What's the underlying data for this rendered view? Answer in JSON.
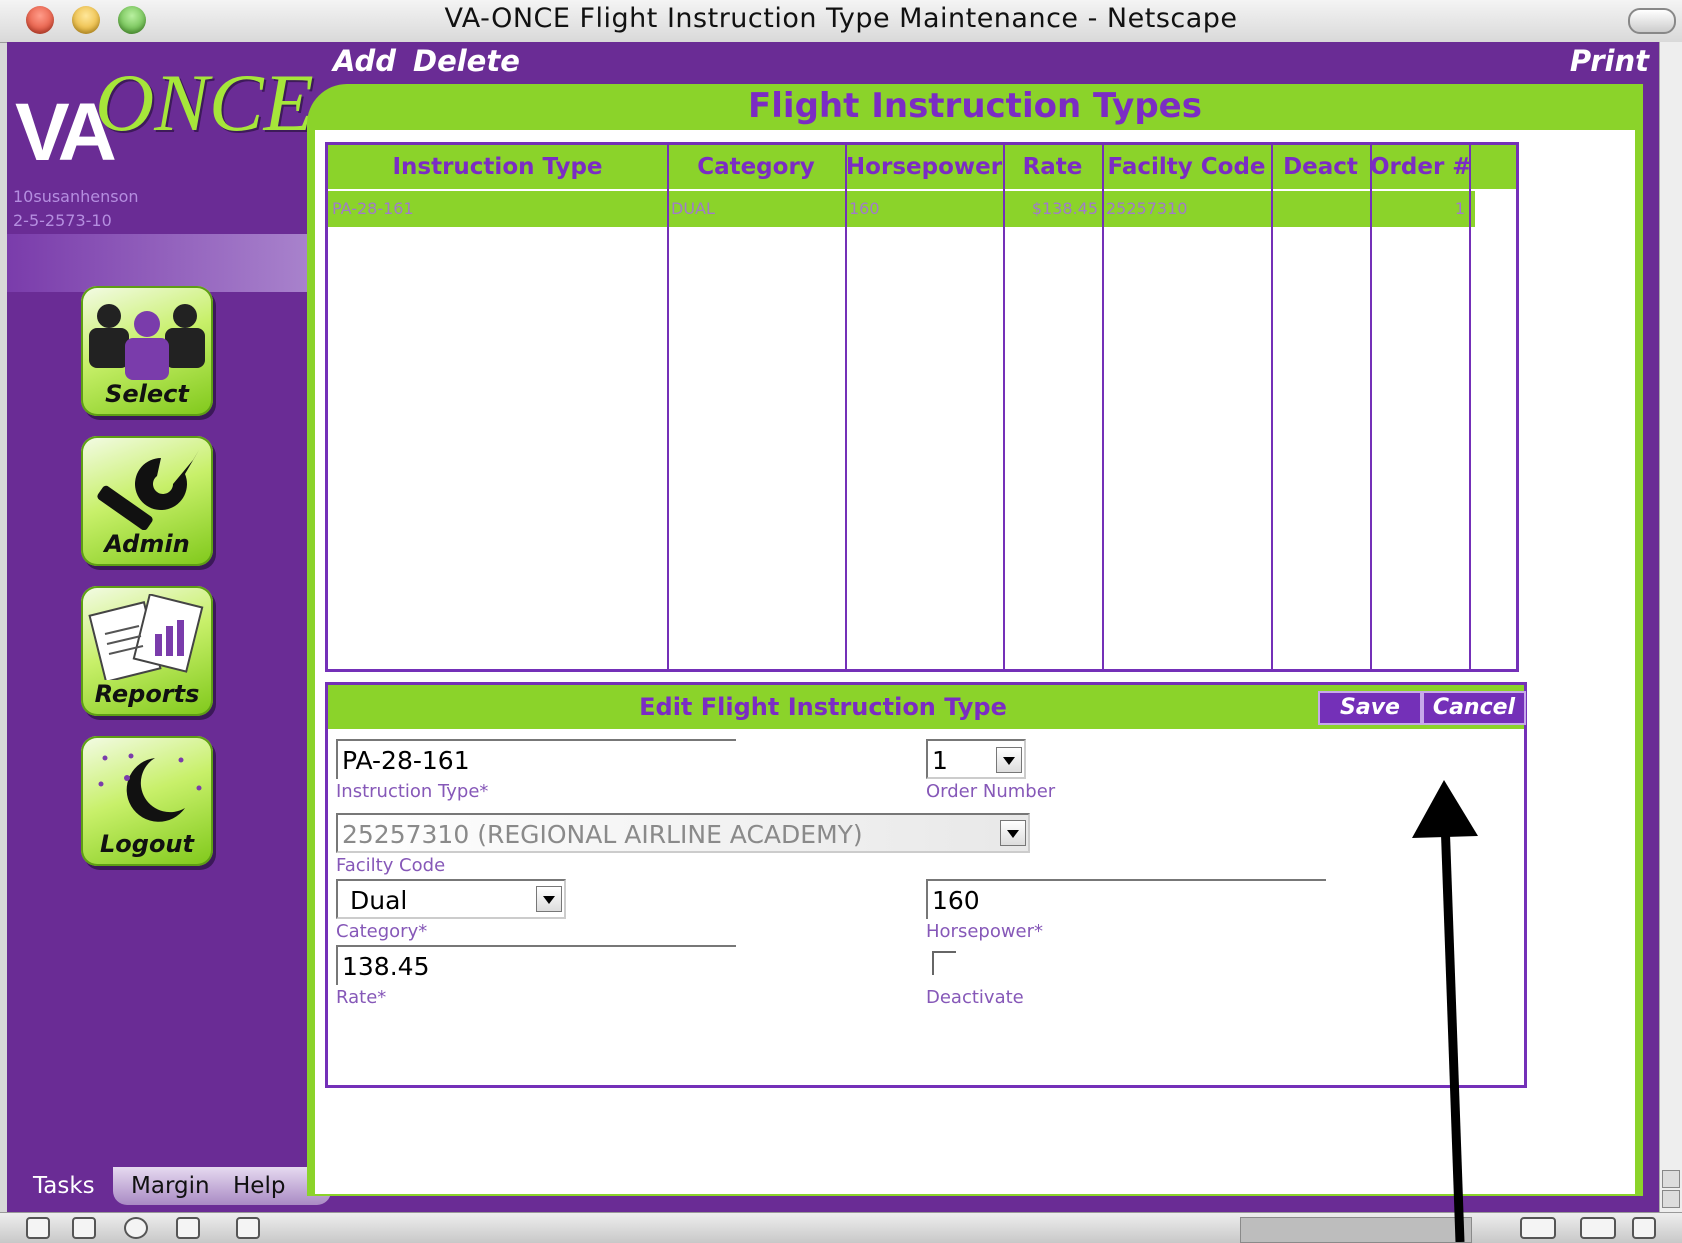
{
  "window": {
    "title": "VA-ONCE Flight Instruction Type Maintenance - Netscape"
  },
  "topbar": {
    "add_label": "Add",
    "delete_label": "Delete",
    "print_label": "Print"
  },
  "logo": {
    "va": "VA",
    "once": "ONCE"
  },
  "user": {
    "name": "10susanhenson",
    "id": "2-5-2573-10"
  },
  "nav": {
    "select_label": "Select",
    "admin_label": "Admin",
    "reports_label": "Reports",
    "logout_label": "Logout",
    "icons": [
      "people-icon",
      "wrench-icon",
      "reports-icon",
      "moon-icon"
    ]
  },
  "tabs": [
    "Tasks",
    "Margin",
    "Help"
  ],
  "page": {
    "title": "Flight Instruction Types"
  },
  "grid": {
    "headers": [
      "Instruction Type",
      "Category",
      "Horsepower",
      "Rate",
      "Facilty Code",
      "Deact",
      "Order #"
    ],
    "rows": [
      [
        "PA-28-161",
        "DUAL",
        "160",
        "$138.45",
        "25257310",
        "",
        "1"
      ]
    ]
  },
  "edit": {
    "title": "Edit Flight Instruction Type",
    "save_label": "Save",
    "cancel_label": "Cancel",
    "instruction_type": {
      "value": "PA-28-161",
      "label": "Instruction Type*"
    },
    "order_number": {
      "value": "1",
      "label": "Order Number"
    },
    "facility_code": {
      "value": "25257310 (REGIONAL AIRLINE ACADEMY)",
      "label": "Facilty Code"
    },
    "category": {
      "value": "Dual",
      "label": "Category*"
    },
    "horsepower": {
      "value": "160",
      "label": "Horsepower*"
    },
    "rate": {
      "value": "138.45",
      "label": "Rate*"
    },
    "deactivate": {
      "checked": false,
      "label": "Deactivate"
    }
  },
  "colors": {
    "purple": "#6a2c95",
    "green": "#8bd32a",
    "title_purple": "#7b2cc4"
  }
}
